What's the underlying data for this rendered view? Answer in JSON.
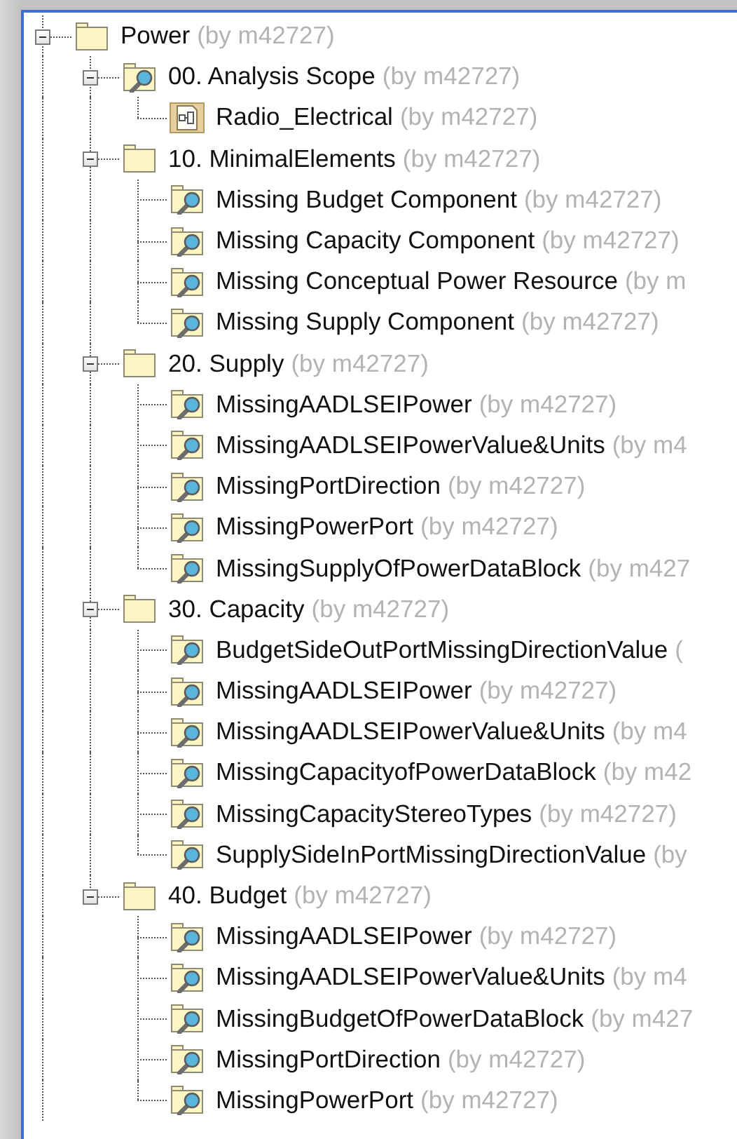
{
  "tree": [
    {
      "label": "Power",
      "owner": "(by m42727)",
      "kind": "folder",
      "expanded": true,
      "children": [
        {
          "label": "00. Analysis Scope",
          "owner": "(by m42727)",
          "kind": "analysis",
          "expanded": true,
          "children": [
            {
              "label": "Radio_Electrical",
              "owner": "(by m42727)",
              "kind": "diagram"
            }
          ]
        },
        {
          "label": "10. MinimalElements",
          "owner": "(by m42727)",
          "kind": "folder",
          "expanded": true,
          "children": [
            {
              "label": "Missing Budget Component",
              "owner": "(by m42727)",
              "kind": "analysis"
            },
            {
              "label": "Missing Capacity Component",
              "owner": "(by m42727)",
              "kind": "analysis"
            },
            {
              "label": "Missing Conceptual Power Resource",
              "owner": "(by m",
              "kind": "analysis"
            },
            {
              "label": "Missing Supply Component",
              "owner": "(by m42727)",
              "kind": "analysis"
            }
          ]
        },
        {
          "label": "20. Supply",
          "owner": "(by m42727)",
          "kind": "folder",
          "expanded": true,
          "children": [
            {
              "label": "MissingAADLSEIPower",
              "owner": "(by m42727)",
              "kind": "analysis"
            },
            {
              "label": "MissingAADLSEIPowerValue&Units",
              "owner": "(by m4",
              "kind": "analysis"
            },
            {
              "label": "MissingPortDirection",
              "owner": "(by m42727)",
              "kind": "analysis"
            },
            {
              "label": "MissingPowerPort",
              "owner": "(by m42727)",
              "kind": "analysis"
            },
            {
              "label": "MissingSupplyOfPowerDataBlock",
              "owner": "(by m427",
              "kind": "analysis"
            }
          ]
        },
        {
          "label": "30. Capacity",
          "owner": "(by m42727)",
          "kind": "folder",
          "expanded": true,
          "children": [
            {
              "label": "BudgetSideOutPortMissingDirectionValue",
              "owner": "(",
              "kind": "analysis"
            },
            {
              "label": "MissingAADLSEIPower",
              "owner": "(by m42727)",
              "kind": "analysis"
            },
            {
              "label": "MissingAADLSEIPowerValue&Units",
              "owner": "(by m4",
              "kind": "analysis"
            },
            {
              "label": "MissingCapacityofPowerDataBlock",
              "owner": "(by m42",
              "kind": "analysis"
            },
            {
              "label": "MissingCapacityStereoTypes",
              "owner": "(by m42727)",
              "kind": "analysis"
            },
            {
              "label": "SupplySideInPortMissingDirectionValue",
              "owner": "(by",
              "kind": "analysis"
            }
          ]
        },
        {
          "label": "40. Budget",
          "owner": "(by m42727)",
          "kind": "folder",
          "expanded": true,
          "children": [
            {
              "label": "MissingAADLSEIPower",
              "owner": "(by m42727)",
              "kind": "analysis"
            },
            {
              "label": "MissingAADLSEIPowerValue&Units",
              "owner": "(by m4",
              "kind": "analysis"
            },
            {
              "label": "MissingBudgetOfPowerDataBlock",
              "owner": "(by m427",
              "kind": "analysis"
            },
            {
              "label": "MissingPortDirection",
              "owner": "(by m42727)",
              "kind": "analysis"
            },
            {
              "label": "MissingPowerPort",
              "owner": "(by m42727)",
              "kind": "analysis"
            }
          ]
        }
      ]
    }
  ]
}
